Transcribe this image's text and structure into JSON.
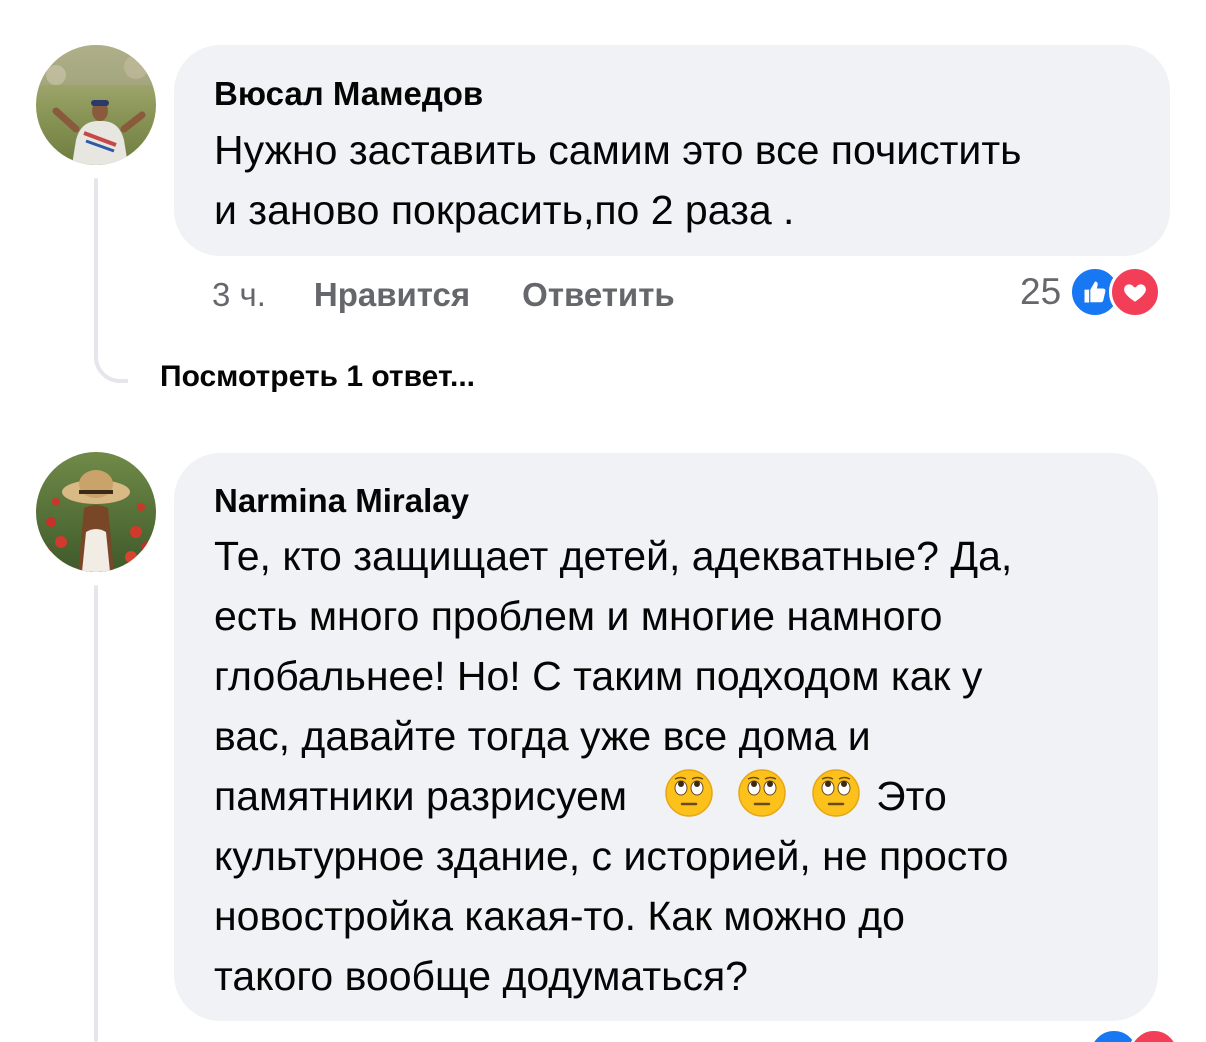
{
  "comments": [
    {
      "author": "Вюсал Мамедов",
      "lines": [
        "Нужно заставить самим это все почистить",
        "и заново покрасить,по 2 раза ."
      ],
      "time": "3 ч.",
      "like_label": "Нравится",
      "reply_label": "Ответить",
      "reaction_count": "25",
      "reactions": [
        "like-icon",
        "love-icon"
      ],
      "view_replies": "Посмотреть 1 ответ..."
    },
    {
      "author": "Narmina Miralay",
      "lines": [
        "Те, кто защищает детей, адекватные? Да,",
        "есть много проблем и многие намного",
        "глобальнее! Но! С таким подходом как у",
        "вас, давайте тогда уже все дома и",
        "памятники разрисуем",
        "культурное здание, с историей, не просто",
        "новостройка какая-то. Как можно до",
        "такого вообще додуматься?"
      ],
      "line5_suffix": "Это",
      "emojis": [
        "face-with-rolling-eyes-icon",
        "face-with-rolling-eyes-icon",
        "face-with-rolling-eyes-icon"
      ]
    }
  ],
  "colors": {
    "bubble": "#f0f2f5",
    "meta": "#65676b",
    "like_blue": "#1877f2",
    "love_red": "#f33e58"
  }
}
